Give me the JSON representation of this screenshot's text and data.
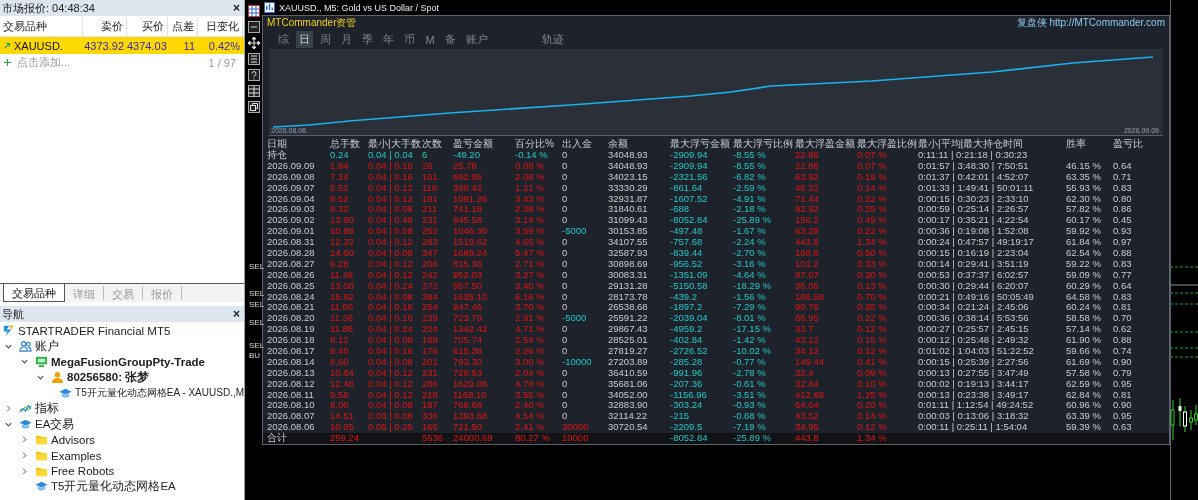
{
  "market_watch": {
    "title": "市场报价: 04:48:34",
    "close": "×",
    "columns": [
      "交易品种",
      "卖价",
      "买价",
      "点差",
      "日变化"
    ],
    "rows": [
      {
        "symbol": "XAUUSD.",
        "bid": "4373.92",
        "ask": "4374.03",
        "spread": "11",
        "change": "0.42%",
        "selected": true
      }
    ],
    "add_label": "点击添加...",
    "count": "1 / 97"
  },
  "bottom_tabs": [
    {
      "label": "交易品种",
      "selected": true
    },
    {
      "label": "详细",
      "selected": false
    },
    {
      "label": "交易",
      "selected": false
    },
    {
      "label": "报价",
      "selected": false
    }
  ],
  "navigator": {
    "title": "导航",
    "close": "×",
    "tree": [
      {
        "label": "STARTRADER Financial MT5",
        "kind": "broker",
        "children": [
          {
            "label": "账户",
            "kind": "accounts",
            "expanded": true,
            "children": [
              {
                "label": "MegaFusionGroupPty-Trade",
                "kind": "server",
                "expanded": true,
                "children": [
                  {
                    "label": "80256580: 张梦",
                    "kind": "account",
                    "expanded": true,
                    "children": [
                      {
                        "label": "T5开元量化动态网格EA - XAUUSD.,M",
                        "kind": "ea"
                      }
                    ]
                  }
                ]
              }
            ]
          },
          {
            "label": "指标",
            "kind": "indicators",
            "expanded": false
          },
          {
            "label": "EA交易",
            "kind": "experts",
            "expanded": true,
            "children": [
              {
                "label": "Advisors",
                "kind": "folder",
                "expanded": false
              },
              {
                "label": "Examples",
                "kind": "folder",
                "expanded": false
              },
              {
                "label": "Free Robots",
                "kind": "folder",
                "expanded": false
              },
              {
                "label": "T5开元量化动态网格EA",
                "kind": "ea"
              }
            ]
          }
        ]
      }
    ]
  },
  "chart_window": {
    "title": "XAUUSD., M5:  Gold vs US Dollar / Spot",
    "chart_labels": [
      "SEL",
      "SEL",
      "SEL",
      "SEL",
      "SEL",
      "BU"
    ]
  },
  "report": {
    "brand": "MTCommander资管",
    "site": "复盘侠 http://MTCommander.com",
    "period_tabs": [
      {
        "label": "综",
        "selected": false
      },
      {
        "label": "日",
        "selected": true
      },
      {
        "label": "周",
        "selected": false
      },
      {
        "label": "月",
        "selected": false
      },
      {
        "label": "季",
        "selected": false
      },
      {
        "label": "年",
        "selected": false
      },
      {
        "label": "币",
        "selected": false
      },
      {
        "label": "M",
        "selected": false
      },
      {
        "label": "备",
        "selected": false
      },
      {
        "label": "账户",
        "selected": false
      }
    ],
    "extra_tabs": [
      {
        "label": "轨迹",
        "selected": false
      }
    ],
    "equity_start": "2026.08.06",
    "equity_end": "2026.09.09",
    "columns": [
      "日期",
      "总手数",
      "最小|大手数",
      "次数",
      "盈亏金额",
      "百分比%",
      "出入金",
      "余额",
      "最大浮亏金额",
      "最大浮亏比例",
      "最大浮盈金额",
      "最大浮盈比例",
      "最小|平均|最大持仓时间",
      "胜率",
      "盈亏比"
    ],
    "rows": [
      {
        "kind": "open",
        "d": "持仓",
        "lots": "0.24",
        "mm": "0.04 | 0.04",
        "n": "6",
        "pnl": "-49.20",
        "pct": "-0.14 %",
        "dep": "0",
        "bal": "34048.93",
        "dd": "-2909.94",
        "ddp": "-8.55 %",
        "fl": "22.86",
        "flp": "0.07 %",
        "t": "0:11:11 | 0:21:18 | 0:30:23"
      },
      {
        "kind": "day",
        "d": "2026.09.09",
        "lots": "1.84",
        "mm": "0.04 | 0.16",
        "n": "26",
        "pnl": "25.78",
        "pct": "0.08 %",
        "dep": "0",
        "bal": "34048.93",
        "dd": "-2909.94",
        "ddp": "-8.55 %",
        "fl": "22.86",
        "flp": "0.07 %",
        "t": "0:01:57 | 3:48:30 | 7:50:51",
        "win": "46.15 %",
        "pr": "0.64"
      },
      {
        "kind": "day",
        "d": "2026.09.08",
        "lots": "7.24",
        "mm": "0.04 | 0.16",
        "n": "161",
        "pnl": "692.86",
        "pct": "2.08 %",
        "dep": "0",
        "bal": "34023.15",
        "dd": "-2321.56",
        "ddp": "-6.82 %",
        "fl": "63.92",
        "flp": "0.19 %",
        "t": "0:01:37 | 0:42:01 | 4:52:07",
        "win": "63.35 %",
        "pr": "0.71"
      },
      {
        "kind": "day",
        "d": "2026.09.07",
        "lots": "5.52",
        "mm": "0.04 | 0.12",
        "n": "118",
        "pnl": "398.42",
        "pct": "1.21 %",
        "dep": "0",
        "bal": "33330.29",
        "dd": "-861.64",
        "ddp": "-2.59 %",
        "fl": "46.32",
        "flp": "0.14 %",
        "t": "0:01:33 | 1:49:41 | 50:01:11",
        "win": "55.93 %",
        "pr": "0.83"
      },
      {
        "kind": "day",
        "d": "2026.09.04",
        "lots": "8.52",
        "mm": "0.04 | 0.12",
        "n": "191",
        "pnl": "1091.26",
        "pct": "3.43 %",
        "dep": "0",
        "bal": "32931.87",
        "dd": "-1607.52",
        "ddp": "-4.91 %",
        "fl": "71.44",
        "flp": "0.22 %",
        "t": "0:00:15 | 0:30:23 | 2:33:10",
        "win": "62.30 %",
        "pr": "0.80"
      },
      {
        "kind": "day",
        "d": "2026.09.03",
        "lots": "9.32",
        "mm": "0.04 | 0.08",
        "n": "211",
        "pnl": "741.18",
        "pct": "2.38 %",
        "dep": "0",
        "bal": "31840.61",
        "dd": "-688",
        "ddp": "-2.18 %",
        "fl": "92.92",
        "flp": "0.29 %",
        "t": "0:00:59 | 0:25:14 | 2:26:57",
        "win": "57.82 %",
        "pr": "0.86"
      },
      {
        "kind": "day",
        "d": "2026.09.02",
        "lots": "13.60",
        "mm": "0.04 | 0.48",
        "n": "231",
        "pnl": "945.58",
        "pct": "3.14 %",
        "dep": "0",
        "bal": "31099.43",
        "dd": "-8052.84",
        "ddp": "-25.89 %",
        "fl": "150.2",
        "flp": "0.49 %",
        "t": "0:00:17 | 0:35:21 | 4:22:54",
        "win": "60.17 %",
        "pr": "0.45"
      },
      {
        "kind": "withdrawal",
        "d": "2026.09.01",
        "lots": "10.88",
        "mm": "0.04 | 0.08",
        "n": "252",
        "pnl": "1046.30",
        "pct": "3.59 %",
        "dep": "-5000",
        "bal": "30153.85",
        "dd": "-497.48",
        "ddp": "-1.67 %",
        "fl": "63.28",
        "flp": "0.22 %",
        "t": "0:00:36 | 0:19:08 | 1:52:08",
        "win": "59.92 %",
        "pr": "0.93"
      },
      {
        "kind": "day",
        "d": "2026.08.31",
        "lots": "12.32",
        "mm": "0.04 | 0.12",
        "n": "283",
        "pnl": "1519.62",
        "pct": "4.66 %",
        "dep": "0",
        "bal": "34107.55",
        "dd": "-757.68",
        "ddp": "-2.24 %",
        "fl": "443.8",
        "flp": "1.34 %",
        "t": "0:00:24 | 0:47:57 | 49:19:17",
        "win": "61.84 %",
        "pr": "0.97"
      },
      {
        "kind": "day",
        "d": "2026.08.28",
        "lots": "14.60",
        "mm": "0.04 | 0.08",
        "n": "347",
        "pnl": "1689.24",
        "pct": "5.47 %",
        "dep": "0",
        "bal": "32587.93",
        "dd": "-839.44",
        "ddp": "-2.70 %",
        "fl": "160.8",
        "flp": "0.50 %",
        "t": "0:00:15 | 0:16:19 | 2:23:04",
        "win": "62.54 %",
        "pr": "0.88"
      },
      {
        "kind": "day",
        "d": "2026.08.27",
        "lots": "9.28",
        "mm": "0.04 | 0.12",
        "n": "206",
        "pnl": "815.38",
        "pct": "2.71 %",
        "dep": "0",
        "bal": "30898.69",
        "dd": "-956.52",
        "ddp": "-3.16 %",
        "fl": "101.2",
        "flp": "0.33 %",
        "t": "0:00:14 | 0:29:41 | 3:51:19",
        "win": "59.22 %",
        "pr": "0.83"
      },
      {
        "kind": "day",
        "d": "2026.08.26",
        "lots": "11.48",
        "mm": "0.04 | 0.12",
        "n": "242",
        "pnl": "952.03",
        "pct": "3.27 %",
        "dep": "0",
        "bal": "30083.31",
        "dd": "-1351.09",
        "ddp": "-4.64 %",
        "fl": "87.07",
        "flp": "0.30 %",
        "t": "0:00:53 | 0:37:37 | 6:02:57",
        "win": "59.09 %",
        "pr": "0.77"
      },
      {
        "kind": "day",
        "d": "2026.08.25",
        "lots": "13.08",
        "mm": "0.04 | 0.24",
        "n": "272",
        "pnl": "957.50",
        "pct": "3.40 %",
        "dep": "0",
        "bal": "29131.28",
        "dd": "-5150.58",
        "ddp": "-18.29 %",
        "fl": "36.06",
        "flp": "0.13 %",
        "t": "0:00:30 | 0:29:44 | 6:20:07",
        "win": "60.29 %",
        "pr": "0.64"
      },
      {
        "kind": "day",
        "d": "2026.08.24",
        "lots": "15.92",
        "mm": "0.04 | 0.08",
        "n": "384",
        "pnl": "1635.10",
        "pct": "6.16 %",
        "dep": "0",
        "bal": "28173.78",
        "dd": "-439.2",
        "ddp": "-1.56 %",
        "fl": "186.58",
        "flp": "0.70 %",
        "t": "0:00:21 | 0:49:16 | 50:05:49",
        "win": "64.58 %",
        "pr": "0.83"
      },
      {
        "kind": "day",
        "d": "2026.08.21",
        "lots": "11.60",
        "mm": "0.04 | 0.16",
        "n": "254",
        "pnl": "947.46",
        "pct": "3.70 %",
        "dep": "0",
        "bal": "26538.68",
        "dd": "-1897.2",
        "ddp": "-7.29 %",
        "fl": "90.76",
        "flp": "0.35 %",
        "t": "0:00:34 | 0:21:24 | 2:45:06",
        "win": "60.24 %",
        "pr": "0.81"
      },
      {
        "kind": "withdrawal",
        "d": "2026.08.20",
        "lots": "11.36",
        "mm": "0.04 | 0.16",
        "n": "239",
        "pnl": "723.79",
        "pct": "2.91 %",
        "dep": "-5000",
        "bal": "25591.22",
        "dd": "-2039.04",
        "ddp": "-8.01 %",
        "fl": "66.95",
        "flp": "0.22 %",
        "t": "0:00:36 | 0:38:14 | 5:53:56",
        "win": "58.58 %",
        "pr": "0.70"
      },
      {
        "kind": "day",
        "d": "2026.08.19",
        "lots": "11.88",
        "mm": "0.04 | 0.24",
        "n": "224",
        "pnl": "1342.42",
        "pct": "4.71 %",
        "dep": "0",
        "bal": "29867.43",
        "dd": "-4959.2",
        "ddp": "-17.15 %",
        "fl": "33.7",
        "flp": "0.12 %",
        "t": "0:00:27 | 0:25:57 | 2:45:15",
        "win": "57.14 %",
        "pr": "0.62"
      },
      {
        "kind": "day",
        "d": "2026.08.18",
        "lots": "8.12",
        "mm": "0.04 | 0.08",
        "n": "189",
        "pnl": "705.74",
        "pct": "2.54 %",
        "dep": "0",
        "bal": "28525.01",
        "dd": "-402.84",
        "ddp": "-1.42 %",
        "fl": "43.12",
        "flp": "0.15 %",
        "t": "0:00:12 | 0:25:48 | 2:49:32",
        "win": "61.90 %",
        "pr": "0.88"
      },
      {
        "kind": "day",
        "d": "2026.08.17",
        "lots": "8.40",
        "mm": "0.04 | 0.16",
        "n": "176",
        "pnl": "615.38",
        "pct": "2.26 %",
        "dep": "0",
        "bal": "27819.27",
        "dd": "-2726.52",
        "ddp": "-10.02 %",
        "fl": "34.12",
        "flp": "0.12 %",
        "t": "0:01:02 | 1:04:03 | 51:22:52",
        "win": "59.66 %",
        "pr": "0.74"
      },
      {
        "kind": "withdrawal",
        "d": "2026.08.14",
        "lots": "8.60",
        "mm": "0.04 | 0.08",
        "n": "201",
        "pnl": "793.30",
        "pct": "3.00 %",
        "dep": "-10000",
        "bal": "27203.89",
        "dd": "-285.28",
        "ddp": "-0.77 %",
        "fl": "149.44",
        "flp": "0.41 %",
        "t": "0:00:15 | 0:25:39 | 2:27:56",
        "win": "61.69 %",
        "pr": "0.90"
      },
      {
        "kind": "day",
        "d": "2026.08.13",
        "lots": "10.84",
        "mm": "0.04 | 0.12",
        "n": "231",
        "pnl": "729.53",
        "pct": "2.04 %",
        "dep": "0",
        "bal": "36410.59",
        "dd": "-991.96",
        "ddp": "-2.78 %",
        "fl": "32.4",
        "flp": "0.09 %",
        "t": "0:00:13 | 0:27:55 | 3:47:49",
        "win": "57.58 %",
        "pr": "0.79"
      },
      {
        "kind": "day",
        "d": "2026.08.12",
        "lots": "12.48",
        "mm": "0.04 | 0.12",
        "n": "286",
        "pnl": "1629.06",
        "pct": "4.78 %",
        "dep": "0",
        "bal": "35681.06",
        "dd": "-207.36",
        "ddp": "-0.61 %",
        "fl": "32.84",
        "flp": "0.10 %",
        "t": "0:00:02 | 0:19:13 | 3:44:17",
        "win": "62.59 %",
        "pr": "0.95"
      },
      {
        "kind": "day",
        "d": "2026.08.11",
        "lots": "9.56",
        "mm": "0.04 | 0.12",
        "n": "218",
        "pnl": "1168.10",
        "pct": "3.55 %",
        "dep": "0",
        "bal": "34052.00",
        "dd": "-1156.96",
        "ddp": "-3.51 %",
        "fl": "412.68",
        "flp": "1.25 %",
        "t": "0:00:13 | 0:23:38 | 3:49:17",
        "win": "62.84 %",
        "pr": "0.81"
      },
      {
        "kind": "day",
        "d": "2026.08.10",
        "lots": "8.00",
        "mm": "0.04 | 0.08",
        "n": "187",
        "pnl": "769.68",
        "pct": "2.40 %",
        "dep": "0",
        "bal": "32883.90",
        "dd": "-303.24",
        "ddp": "-0.93 %",
        "fl": "64.64",
        "flp": "0.20 %",
        "t": "0:01:11 | 1:12:54 | 49:24:52",
        "win": "60.96 %",
        "pr": "0.90"
      },
      {
        "kind": "day",
        "d": "2026.08.07",
        "lots": "14.51",
        "mm": "0.03 | 0.08",
        "n": "336",
        "pnl": "1393.68",
        "pct": "4.54 %",
        "dep": "0",
        "bal": "32114.22",
        "dd": "-215",
        "ddp": "-0.68 %",
        "fl": "43.52",
        "flp": "0.14 %",
        "t": "0:00:03 | 0:13:06 | 3:18:32",
        "win": "63.39 %",
        "pr": "0.95"
      },
      {
        "kind": "deposit",
        "d": "2026.08.06",
        "lots": "10.05",
        "mm": "0.05 | 0.25",
        "n": "165",
        "pnl": "721.50",
        "pct": "2.41 %",
        "dep": "30000",
        "bal": "30720.54",
        "dd": "-2209.5",
        "ddp": "-7.19 %",
        "fl": "34.95",
        "flp": "0.12 %",
        "t": "0:00:11 | 0:25:11 | 1:54:04",
        "win": "59.39 %",
        "pr": "0.63"
      },
      {
        "kind": "total",
        "d": "合计",
        "lots": "259.24",
        "n": "5636",
        "pnl": "24000.69",
        "pct": "80.27 %",
        "dep": "10000",
        "dd": "-8052.84",
        "ddp": "-25.89 %",
        "fl": "443.8",
        "flp": "1.34 %"
      }
    ]
  }
}
